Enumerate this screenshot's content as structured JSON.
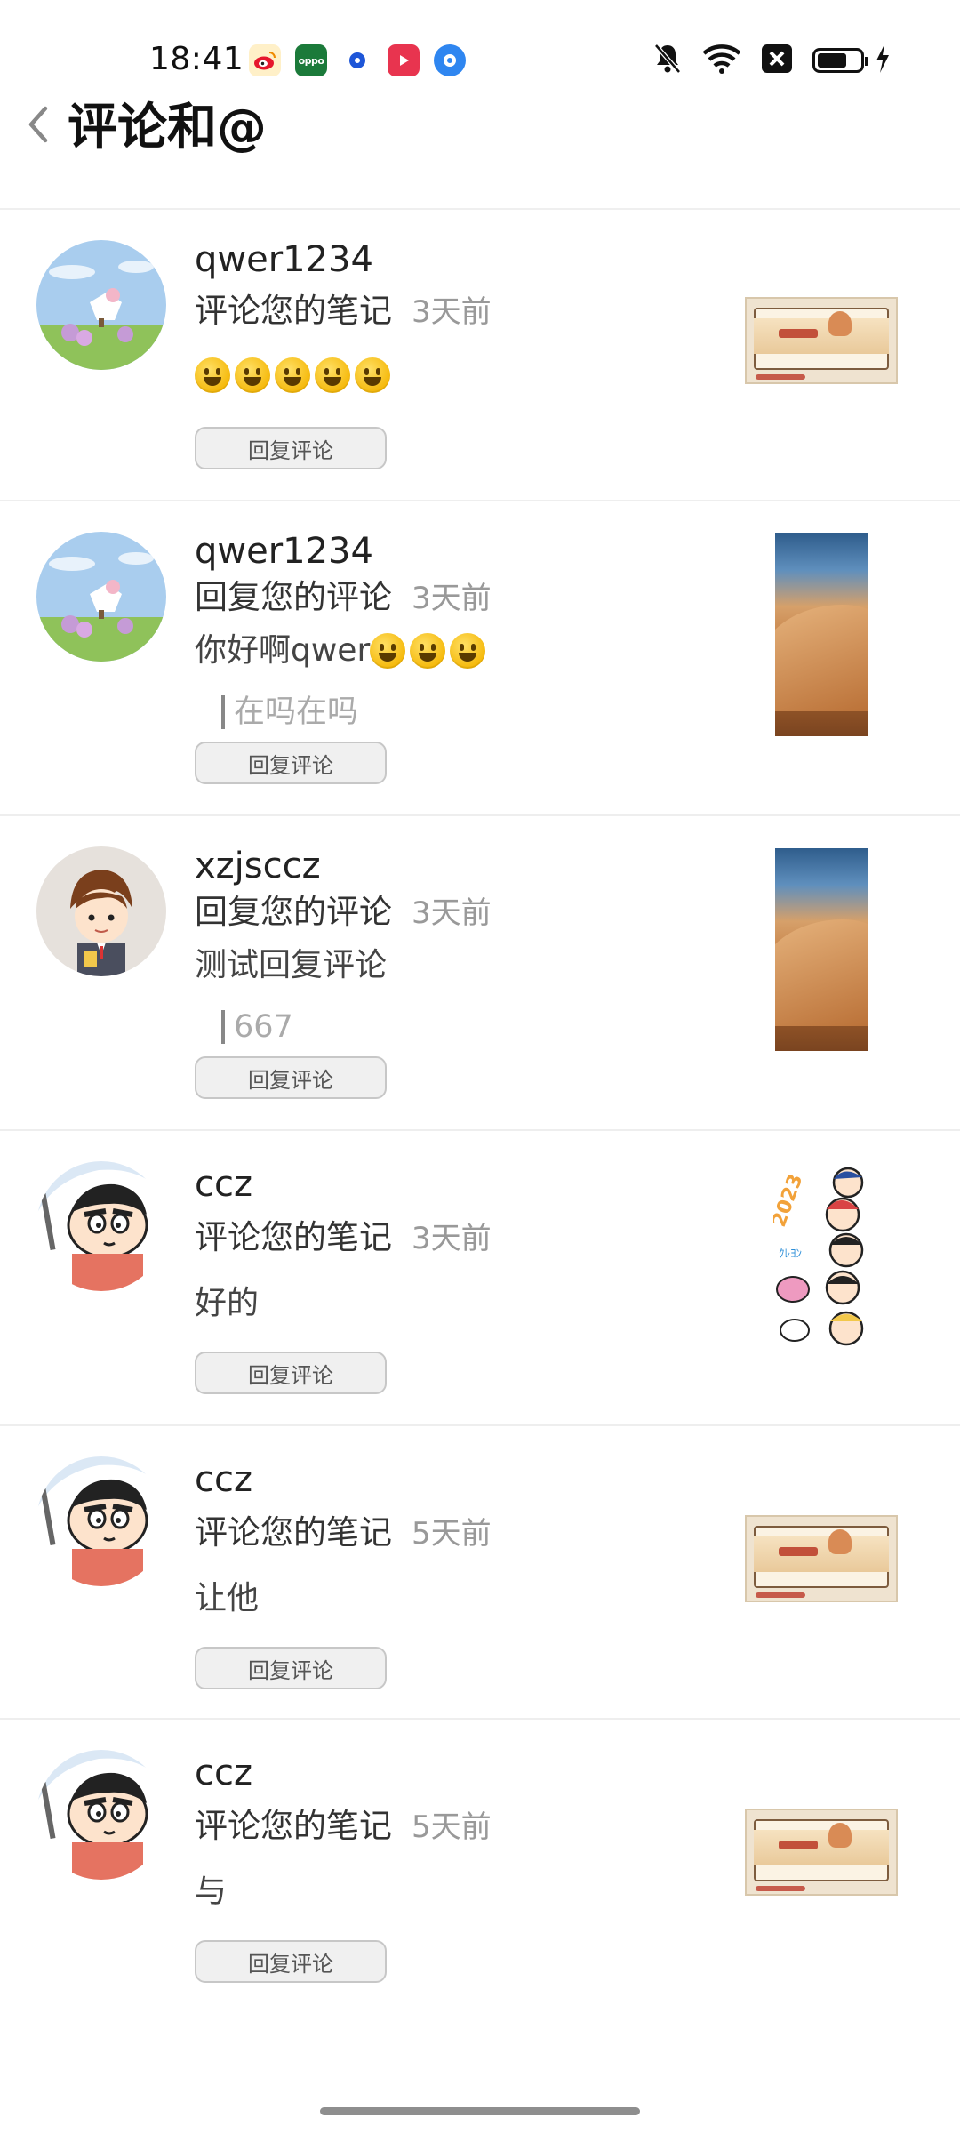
{
  "status_bar": {
    "time": "18:41",
    "apps": [
      "weibo-icon",
      "oppo-icon",
      "blue-ring-icon",
      "video-icon",
      "blue-circle-icon"
    ],
    "battery_level": 0.7
  },
  "header": {
    "title": "评论和@"
  },
  "comments": [
    {
      "username": "qwer1234",
      "action": "评论您的笔记",
      "time": "3天前",
      "content": "",
      "emoji_count": 5,
      "quote": "",
      "reply_label": "回复评论"
    },
    {
      "username": "qwer1234",
      "action": "回复您的评论",
      "time": "3天前",
      "content": "你好啊qwer",
      "emoji_count": 3,
      "quote": "在吗在吗",
      "reply_label": "回复评论"
    },
    {
      "username": "xzjsccz",
      "action": "回复您的评论",
      "time": "3天前",
      "content": "测试回复评论",
      "emoji_count": 0,
      "quote": "667",
      "reply_label": "回复评论"
    },
    {
      "username": "ccz",
      "action": "评论您的笔记",
      "time": "3天前",
      "content": "好的",
      "emoji_count": 0,
      "quote": "",
      "reply_label": "回复评论"
    },
    {
      "username": "ccz",
      "action": "评论您的笔记",
      "time": "5天前",
      "content": "让他",
      "emoji_count": 0,
      "quote": "",
      "reply_label": "回复评论"
    },
    {
      "username": "ccz",
      "action": "评论您的笔记",
      "time": "5天前",
      "content": "与",
      "emoji_count": 0,
      "quote": "",
      "reply_label": "回复评论"
    }
  ]
}
